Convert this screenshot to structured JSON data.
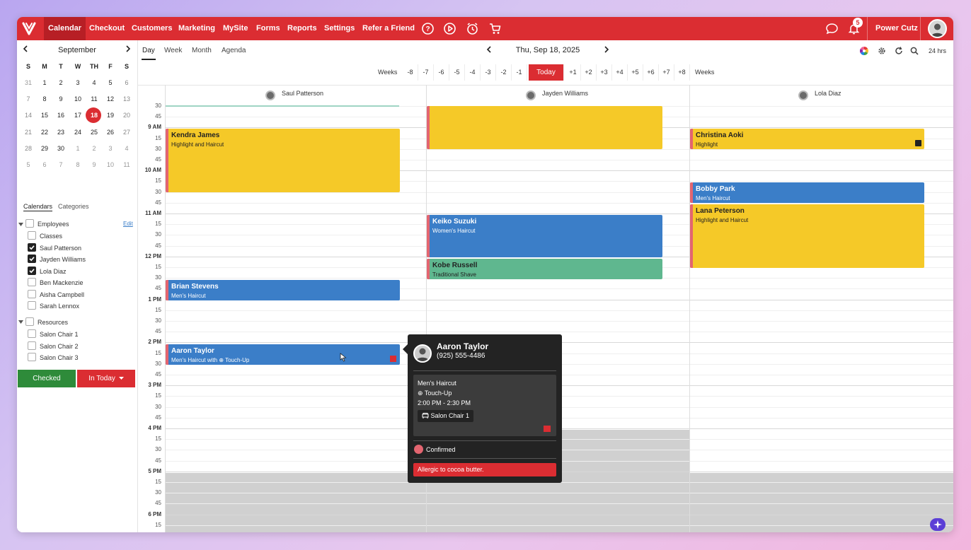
{
  "nav": {
    "items": [
      "Calendar",
      "Checkout",
      "Customers",
      "Marketing",
      "MySite",
      "Forms",
      "Reports",
      "Settings",
      "Refer a Friend"
    ],
    "notification_count": "5",
    "business_name": "Power Cutz",
    "accent": "#db2d32"
  },
  "mini_calendar": {
    "month": "September",
    "weekdays": [
      "S",
      "M",
      "T",
      "W",
      "TH",
      "F",
      "S"
    ],
    "weeks": [
      [
        "31",
        "1",
        "2",
        "3",
        "4",
        "5",
        "6"
      ],
      [
        "7",
        "8",
        "9",
        "10",
        "11",
        "12",
        "13"
      ],
      [
        "14",
        "15",
        "16",
        "17",
        "18",
        "19",
        "20"
      ],
      [
        "21",
        "22",
        "23",
        "24",
        "25",
        "26",
        "27"
      ],
      [
        "28",
        "29",
        "30",
        "1",
        "2",
        "3",
        "4"
      ],
      [
        "5",
        "6",
        "7",
        "8",
        "9",
        "10",
        "11"
      ]
    ],
    "selected": "18"
  },
  "sidebar": {
    "tabs": [
      "Calendars",
      "Categories"
    ],
    "employees_label": "Employees",
    "edit_label": "Edit",
    "employees": [
      {
        "name": "Classes",
        "checked": false
      },
      {
        "name": "Saul Patterson",
        "checked": true
      },
      {
        "name": "Jayden Williams",
        "checked": true
      },
      {
        "name": "Lola Diaz",
        "checked": true
      },
      {
        "name": "Ben Mackenzie",
        "checked": false
      },
      {
        "name": "Aisha Campbell",
        "checked": false
      },
      {
        "name": "Sarah Lennox",
        "checked": false
      }
    ],
    "resources_label": "Resources",
    "resources": [
      "Salon Chair 1",
      "Salon Chair 2",
      "Salon Chair 3"
    ],
    "checked_button": "Checked",
    "in_today_button": "In Today"
  },
  "toolbar": {
    "views": [
      "Day",
      "Week",
      "Month",
      "Agenda"
    ],
    "active_view": "Day",
    "date": "Thu, Sep 18, 2025",
    "hours_label": "24 hrs",
    "weeks_label": "Weeks",
    "week_offsets_before": [
      "-8",
      "-7",
      "-6",
      "-5",
      "-4",
      "-3",
      "-2",
      "-1"
    ],
    "today_label": "Today",
    "week_offsets_after": [
      "+1",
      "+2",
      "+3",
      "+4",
      "+5",
      "+6",
      "+7",
      "+8"
    ]
  },
  "staff_columns": [
    "Saul Patterson",
    "Jayden Williams",
    "Lola Diaz"
  ],
  "time_labels": [
    {
      "t": "30",
      "hr": false
    },
    {
      "t": "45",
      "hr": false
    },
    {
      "t": "9 AM",
      "hr": true
    },
    {
      "t": "15",
      "hr": false
    },
    {
      "t": "30",
      "hr": false
    },
    {
      "t": "45",
      "hr": false
    },
    {
      "t": "10 AM",
      "hr": true
    },
    {
      "t": "15",
      "hr": false
    },
    {
      "t": "30",
      "hr": false
    },
    {
      "t": "45",
      "hr": false
    },
    {
      "t": "11 AM",
      "hr": true
    },
    {
      "t": "15",
      "hr": false
    },
    {
      "t": "30",
      "hr": false
    },
    {
      "t": "45",
      "hr": false
    },
    {
      "t": "12 PM",
      "hr": true
    },
    {
      "t": "15",
      "hr": false
    },
    {
      "t": "30",
      "hr": false
    },
    {
      "t": "45",
      "hr": false
    },
    {
      "t": "1 PM",
      "hr": true
    },
    {
      "t": "15",
      "hr": false
    },
    {
      "t": "30",
      "hr": false
    },
    {
      "t": "45",
      "hr": false
    },
    {
      "t": "2 PM",
      "hr": true
    },
    {
      "t": "15",
      "hr": false
    },
    {
      "t": "30",
      "hr": false
    },
    {
      "t": "45",
      "hr": false
    },
    {
      "t": "3 PM",
      "hr": true
    },
    {
      "t": "15",
      "hr": false
    },
    {
      "t": "30",
      "hr": false
    },
    {
      "t": "45",
      "hr": false
    },
    {
      "t": "4 PM",
      "hr": true
    },
    {
      "t": "15",
      "hr": false
    },
    {
      "t": "30",
      "hr": false
    },
    {
      "t": "45",
      "hr": false
    },
    {
      "t": "5 PM",
      "hr": true
    },
    {
      "t": "15",
      "hr": false
    },
    {
      "t": "30",
      "hr": false
    },
    {
      "t": "45",
      "hr": false
    },
    {
      "t": "6 PM",
      "hr": true
    },
    {
      "t": "15",
      "hr": false
    }
  ],
  "appointments": {
    "kendra": {
      "name": "Kendra James",
      "service": "Highlight and Haircut"
    },
    "brian": {
      "name": "Brian Stevens",
      "service": "Men's Haircut"
    },
    "aaron": {
      "name": "Aaron Taylor",
      "service": "Men's Haircut with ⊕ Touch-Up"
    },
    "keiko": {
      "name": "Keiko Suzuki",
      "service": "Women's Haircut"
    },
    "kobe": {
      "name": "Kobe Russell",
      "service": "Traditional Shave"
    },
    "christina": {
      "name": "Christina Aoki",
      "service": "Highlight"
    },
    "bobby": {
      "name": "Bobby Park",
      "service": "Men's Haircut"
    },
    "lana": {
      "name": "Lana Peterson",
      "service": "Highlight and Haircut"
    }
  },
  "popup": {
    "name": "Aaron Taylor",
    "phone": "(925) 555-4486",
    "service": "Men's Haircut",
    "addon": "⊕ Touch-Up",
    "time": "2:00 PM - 2:30 PM",
    "resource": "Salon Chair 1",
    "status": "Confirmed",
    "note": "Allergic to cocoa butter."
  },
  "colors": {
    "appointment_blue": "#3b7ec8",
    "appointment_yellow": "#f5c928",
    "appointment_green": "#5fb78f",
    "checked_green": "#2e8b3a"
  }
}
